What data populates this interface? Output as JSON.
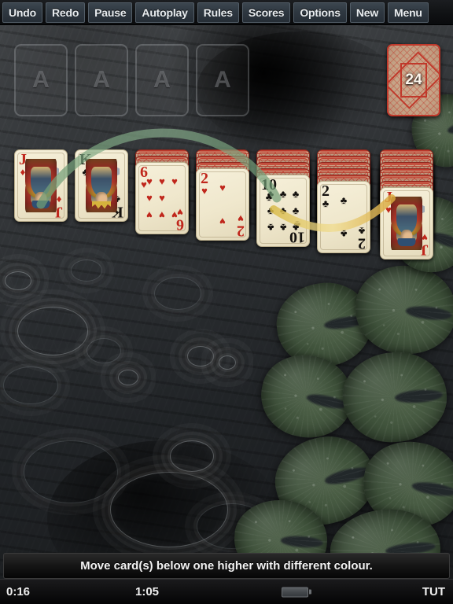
{
  "toolbar": {
    "buttons": [
      {
        "label": "Undo",
        "name": "undo-button"
      },
      {
        "label": "Redo",
        "name": "redo-button"
      },
      {
        "label": "Pause",
        "name": "pause-button"
      },
      {
        "label": "Autoplay",
        "name": "autoplay-button"
      },
      {
        "label": "Rules",
        "name": "rules-button"
      },
      {
        "label": "Scores",
        "name": "scores-button"
      },
      {
        "label": "Options",
        "name": "options-button"
      },
      {
        "label": "New",
        "name": "new-game-button"
      },
      {
        "label": "Menu",
        "name": "menu-button"
      }
    ]
  },
  "foundations": [
    {
      "placeholder": "A"
    },
    {
      "placeholder": "A"
    },
    {
      "placeholder": "A"
    },
    {
      "placeholder": "A"
    }
  ],
  "stock": {
    "count": "24",
    "label": "stock-pile"
  },
  "tableau": {
    "columns": [
      {
        "facedown": 0,
        "card": {
          "rank": "J",
          "suit": "♦",
          "color": "red",
          "type": "court"
        }
      },
      {
        "facedown": 0,
        "card": {
          "rank": "K",
          "suit": "♣",
          "color": "black",
          "type": "court"
        }
      },
      {
        "facedown": 2,
        "card": {
          "rank": "6",
          "suit": "♥",
          "color": "red",
          "type": "number",
          "pips": 6
        }
      },
      {
        "facedown": 3,
        "card": {
          "rank": "2",
          "suit": "♥",
          "color": "red",
          "type": "number",
          "pips": 2
        }
      },
      {
        "facedown": 4,
        "card": {
          "rank": "10",
          "suit": "♣",
          "color": "black",
          "type": "number",
          "pips": 10
        }
      },
      {
        "facedown": 5,
        "card": {
          "rank": "2",
          "suit": "♣",
          "color": "black",
          "type": "number",
          "pips": 2
        }
      },
      {
        "facedown": 6,
        "card": {
          "rank": "J",
          "suit": "♥",
          "color": "red",
          "type": "court"
        }
      }
    ]
  },
  "hint": {
    "text": "Move card(s) below one higher with different colour."
  },
  "status": {
    "game_time": "0:16",
    "total_time": "1:05",
    "battery": "battery-icon",
    "mode": "TUT"
  },
  "colors": {
    "red_suit": "#c0271c",
    "black_suit": "#14110e",
    "card_back_red": "#c0392b",
    "card_face": "#f3ecd4",
    "toolbar_button": "#2f3841",
    "arc_green": "#7fa882",
    "arc_yellow": "#e8c84a"
  }
}
